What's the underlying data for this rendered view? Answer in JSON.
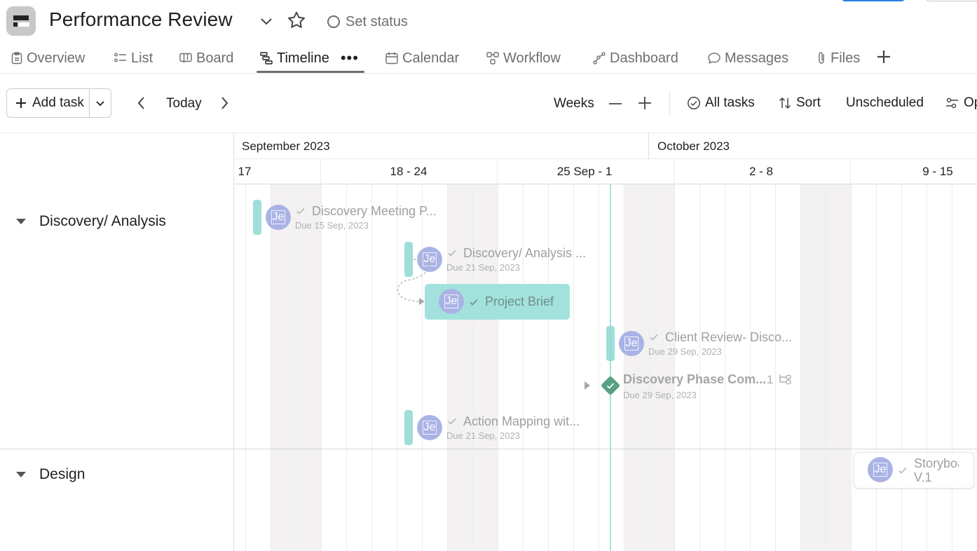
{
  "header": {
    "title": "Performance Review",
    "status": "Set status"
  },
  "tabs": [
    {
      "label": "Overview",
      "icon": "clipboard-icon"
    },
    {
      "label": "List",
      "icon": "list-icon"
    },
    {
      "label": "Board",
      "icon": "board-icon"
    },
    {
      "label": "Timeline",
      "icon": "timeline-icon",
      "active": true
    },
    {
      "label": "Calendar",
      "icon": "calendar-icon"
    },
    {
      "label": "Workflow",
      "icon": "workflow-icon"
    },
    {
      "label": "Dashboard",
      "icon": "dashboard-icon"
    },
    {
      "label": "Messages",
      "icon": "message-icon"
    },
    {
      "label": "Files",
      "icon": "paperclip-icon"
    }
  ],
  "toolbar": {
    "add_task": "Add task",
    "today": "Today",
    "weeks": "Weeks",
    "all_tasks": "All tasks",
    "sort": "Sort",
    "unscheduled": "Unscheduled",
    "options": "Op"
  },
  "timeline": {
    "months": [
      "September 2023",
      "October 2023"
    ],
    "weeks": [
      "17",
      "18 - 24",
      "25 Sep - 1",
      "2 - 8",
      "9 - 15"
    ]
  },
  "sections": [
    {
      "name": "Discovery/ Analysis"
    },
    {
      "name": "Design"
    }
  ],
  "tasks": [
    {
      "name": "Discovery Meeting P...",
      "due": "Due 15 Sep, 2023",
      "assignee": "Je"
    },
    {
      "name": "Discovery/ Analysis ...",
      "due": "Due 21 Sep, 2023",
      "assignee": "Je"
    },
    {
      "name": "Project Brief",
      "assignee": "Je"
    },
    {
      "name": "Client Review- Disco...",
      "due": "Due 29 Sep, 2023",
      "assignee": "Je"
    },
    {
      "name": "Discovery Phase Com...",
      "due": "Due 29 Sep, 2023",
      "subtask_count": "1"
    },
    {
      "name": "Action Mapping wit...",
      "due": "Due 21 Sep, 2023",
      "assignee": "Je"
    },
    {
      "name_line1": "Storyboa",
      "name_line2": "V.1",
      "assignee": "Je"
    }
  ],
  "colors": {
    "task_bar": "#8ed8d2",
    "avatar": "#aab3e6",
    "milestone": "#58a182",
    "today_line": "#a8e4dc"
  }
}
